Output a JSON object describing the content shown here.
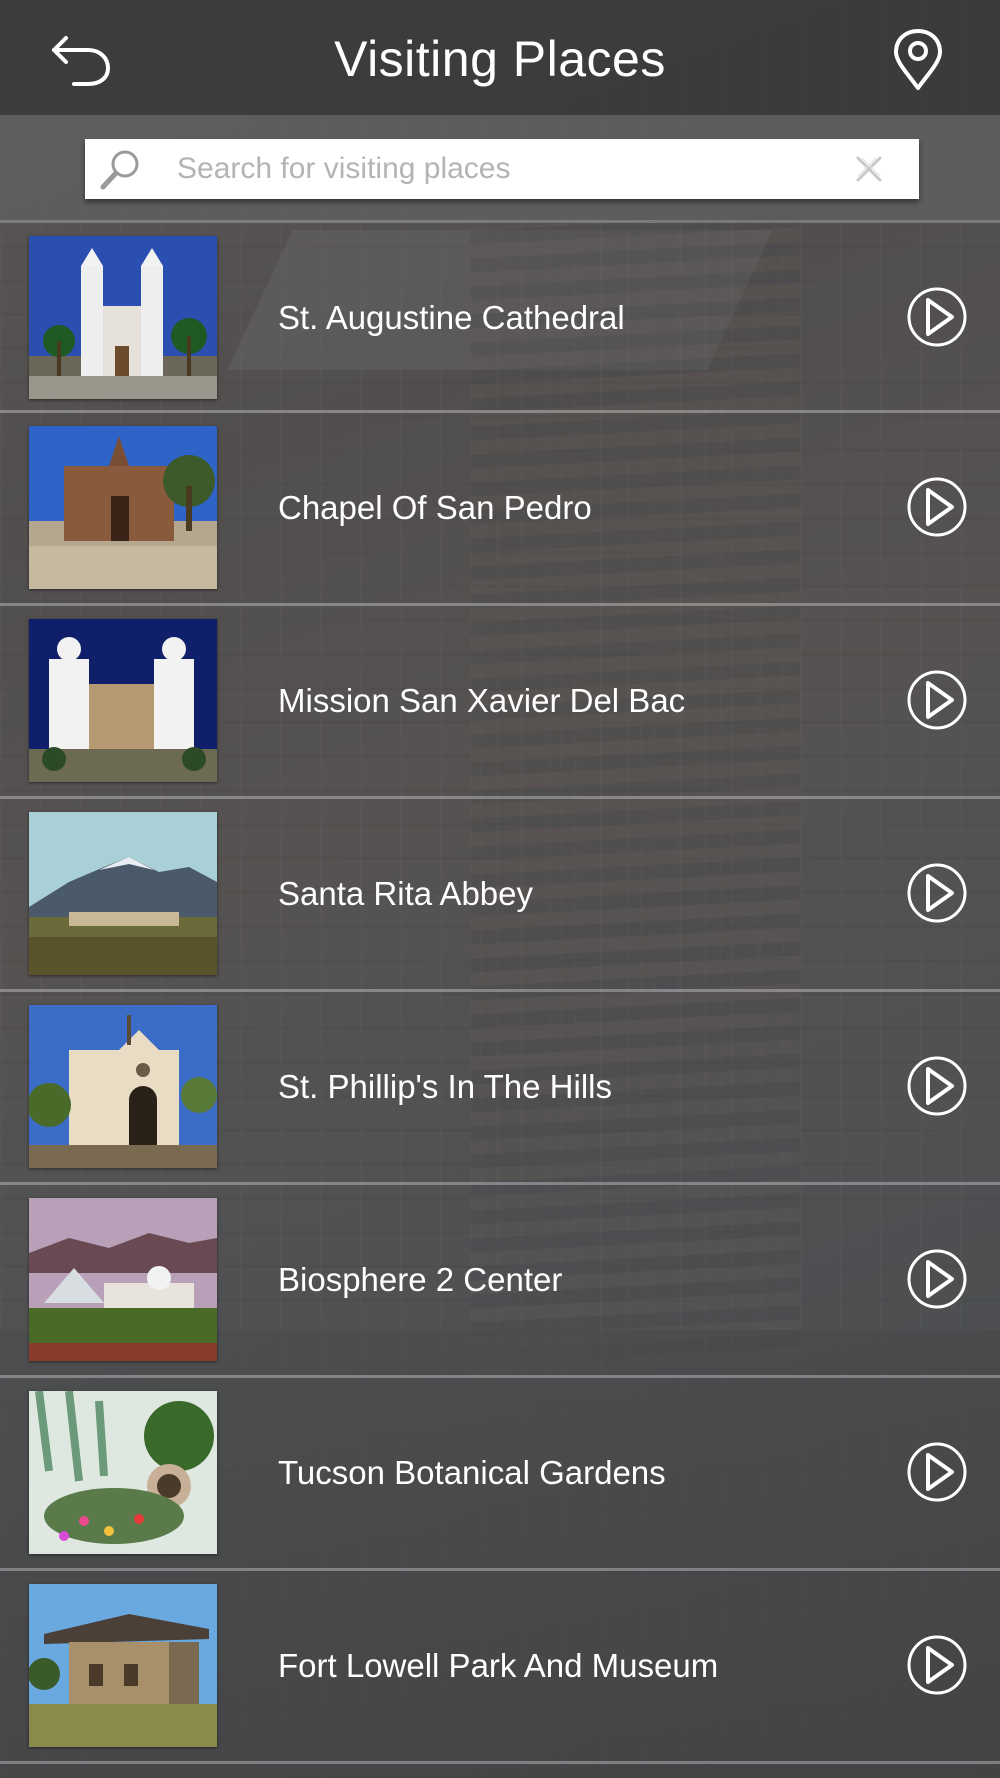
{
  "header": {
    "title": "Visiting Places",
    "back_icon": "back-arrow-icon",
    "map_icon": "map-pin-icon"
  },
  "search": {
    "placeholder": "Search for visiting places",
    "value": ""
  },
  "places": [
    {
      "name": "St. Augustine Cathedral"
    },
    {
      "name": "Chapel Of San Pedro"
    },
    {
      "name": "Mission San Xavier Del Bac"
    },
    {
      "name": "Santa Rita Abbey"
    },
    {
      "name": "St. Phillip's In The Hills"
    },
    {
      "name": "Biosphere 2 Center"
    },
    {
      "name": "Tucson Botanical Gardens"
    },
    {
      "name": "Fort Lowell Park And Museum"
    }
  ],
  "colors": {
    "header_bg": "#3a3a3c",
    "text": "#ffffff",
    "placeholder": "#b4b4b4"
  }
}
